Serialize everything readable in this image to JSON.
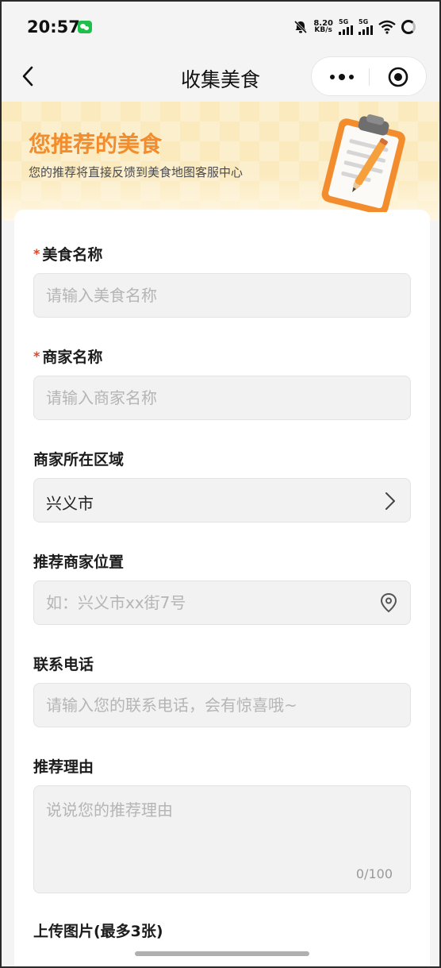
{
  "status_bar": {
    "time": "20:57",
    "speed_value": "8.20",
    "speed_unit": "KB/s",
    "sim1_label": "5G",
    "sim2_label": "5G"
  },
  "nav": {
    "title": "收集美食"
  },
  "banner": {
    "title": "您推荐的美食",
    "subtitle": "您的推荐将直接反馈到美食地图客服中心"
  },
  "form": {
    "required_mark": "*",
    "food_name": {
      "label": "美食名称",
      "placeholder": "请输入美食名称"
    },
    "merchant_name": {
      "label": "商家名称",
      "placeholder": "请输入商家名称"
    },
    "region": {
      "label": "商家所在区域",
      "value": "兴义市"
    },
    "location": {
      "label": "推荐商家位置",
      "placeholder": "如：兴义市xx街7号"
    },
    "phone": {
      "label": "联系电话",
      "placeholder": "请输入您的联系电话，会有惊喜哦~"
    },
    "reason": {
      "label": "推荐理由",
      "placeholder": "说说您的推荐理由",
      "counter": "0/100"
    },
    "upload": {
      "label": "上传图片(最多3张)"
    }
  },
  "colors": {
    "accent": "#f28c2c",
    "required": "#e0452a",
    "wechat": "#1fbf4b"
  }
}
